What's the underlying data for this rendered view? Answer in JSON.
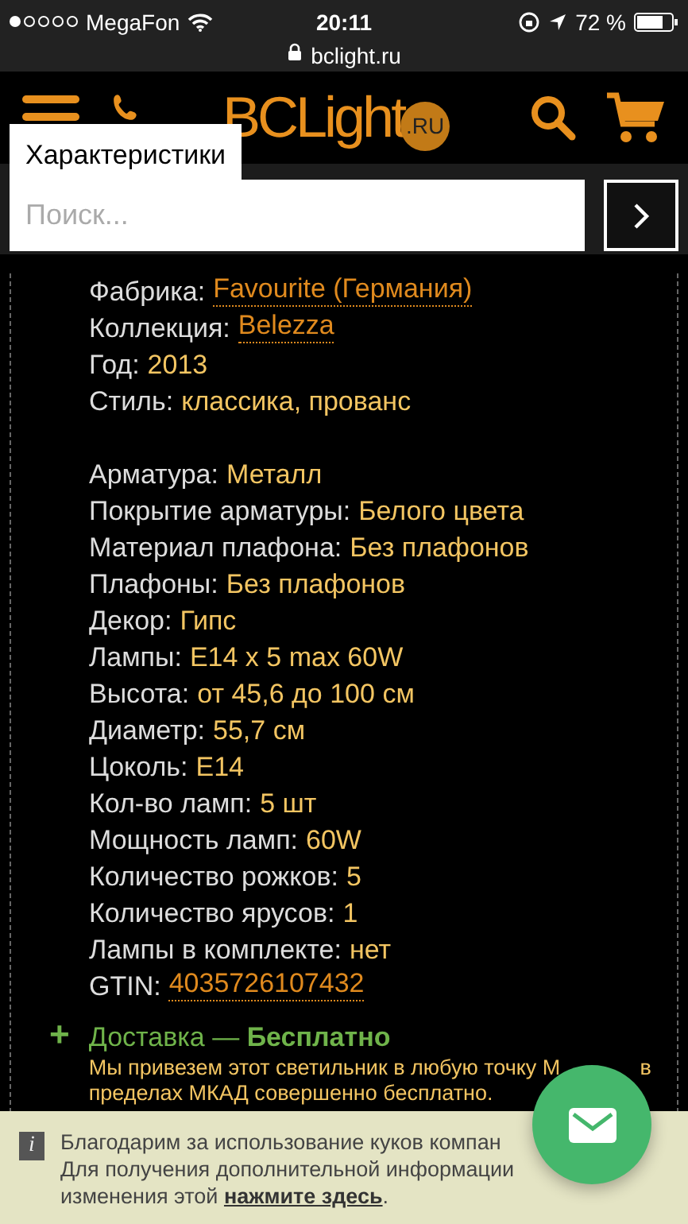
{
  "status_bar": {
    "carrier": "MegaFon",
    "time": "20:11",
    "battery": "72 %",
    "url": "bclight.ru"
  },
  "header": {
    "logo": {
      "text": "BCLight",
      "suffix": ".RU"
    }
  },
  "search": {
    "tab": "Характеристики",
    "placeholder": "Поиск..."
  },
  "spec_groups": [
    [
      {
        "label": "Фабрика:",
        "value": "Favourite (Германия)",
        "kind": "link"
      },
      {
        "label": "Коллекция:",
        "value": "Belezza",
        "kind": "link"
      },
      {
        "label": "Год:",
        "value": "2013",
        "kind": "text"
      },
      {
        "label": "Стиль:",
        "value": "классика, прованс",
        "kind": "text"
      }
    ],
    [
      {
        "label": "Арматура:",
        "value": "Металл",
        "kind": "text"
      },
      {
        "label": "Покрытие арматуры:",
        "value": "Белого цвета",
        "kind": "text"
      },
      {
        "label": "Материал плафона:",
        "value": "Без плафонов",
        "kind": "text"
      },
      {
        "label": "Плафоны:",
        "value": "Без плафонов",
        "kind": "text"
      },
      {
        "label": "Декор:",
        "value": "Гипс",
        "kind": "text"
      },
      {
        "label": "Лампы:",
        "value": "E14 x 5 max 60W",
        "kind": "text"
      },
      {
        "label": "Высота:",
        "value": "от 45,6 до 100 см",
        "kind": "text"
      },
      {
        "label": "Диаметр:",
        "value": "55,7 см",
        "kind": "text"
      },
      {
        "label": "Цоколь:",
        "value": "E14",
        "kind": "text"
      },
      {
        "label": "Кол-во ламп:",
        "value": "5 шт",
        "kind": "text"
      },
      {
        "label": "Мощность ламп:",
        "value": "60W",
        "kind": "text"
      },
      {
        "label": "Количество рожков:",
        "value": "5",
        "kind": "text"
      },
      {
        "label": "Количество ярусов:",
        "value": "1",
        "kind": "text"
      },
      {
        "label": "Лампы в комплекте:",
        "value": "нет",
        "kind": "text"
      },
      {
        "label": "GTIN:",
        "value": "4035726107432",
        "kind": "link"
      }
    ]
  ],
  "delivery": {
    "icon": "+",
    "title": "Доставка — **Бесплатно**",
    "text": "Мы привезем этот светильник в любую точку М",
    "text_tail": "в",
    "text_line2": "пределах МКАД совершенно бесплатно."
  },
  "cookie_banner": {
    "icon": "i",
    "lines": [
      "Благодарим за использование куков компан",
      "Для получения дополнительной информации",
      "изменения этой"
    ],
    "link": "нажмите здесь",
    "link_tail": "."
  }
}
